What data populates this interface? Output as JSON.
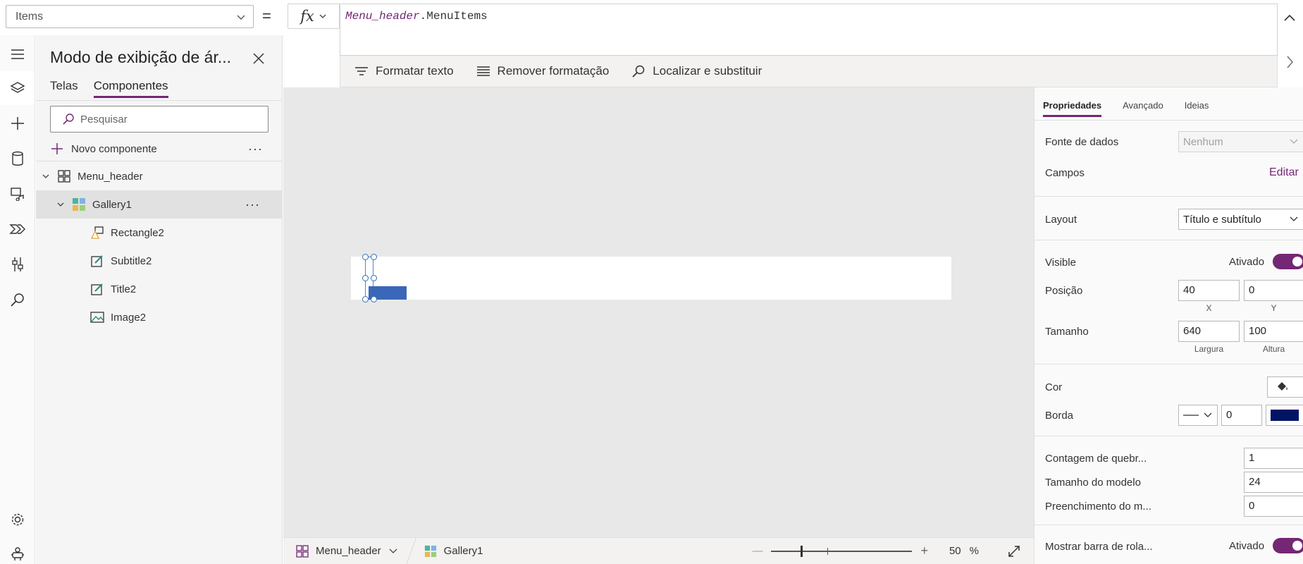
{
  "formula": {
    "property_selected": "Items",
    "equals": "=",
    "fx_label": "fx",
    "expr_control": "Menu_header",
    "expr_dot": ".",
    "expr_property": "MenuItems",
    "tools": {
      "format_text": "Formatar texto",
      "remove_formatting": "Remover formatação",
      "find_replace": "Localizar e substituir"
    }
  },
  "rail": {
    "items": [
      "hamburger-icon",
      "layers-icon",
      "plus-icon",
      "database-icon",
      "media-icon",
      "power-automate-icon",
      "tools-icon",
      "search-icon",
      "settings-icon",
      "virtual-agent-icon"
    ]
  },
  "tree": {
    "title": "Modo de exibição de ár...",
    "tabs": [
      "Telas",
      "Componentes"
    ],
    "active_tab": "Componentes",
    "search_placeholder": "Pesquisar",
    "new_component": "Novo componente",
    "more": "···",
    "nodes": [
      {
        "label": "Menu_header",
        "icon": "component-icon",
        "level": 0,
        "expanded": true
      },
      {
        "label": "Gallery1",
        "icon": "gallery-icon",
        "level": 1,
        "expanded": true,
        "selected": true
      },
      {
        "label": "Rectangle2",
        "icon": "shapes-icon",
        "level": 2
      },
      {
        "label": "Subtitle2",
        "icon": "label-edit-icon",
        "level": 2
      },
      {
        "label": "Title2",
        "icon": "label-edit-icon",
        "level": 2
      },
      {
        "label": "Image2",
        "icon": "image-icon",
        "level": 2
      }
    ]
  },
  "status": {
    "crumb_component": "Menu_header",
    "crumb_control": "Gallery1",
    "zoom_minus": "—",
    "zoom_plus": "+",
    "zoom_value": "50",
    "zoom_unit": "%",
    "zoom_level": 50
  },
  "props": {
    "tabs": [
      "Propriedades",
      "Avançado",
      "Ideias"
    ],
    "active_tab": "Propriedades",
    "data_source_label": "Fonte de dados",
    "data_source_value": "Nenhum",
    "fields_label": "Campos",
    "fields_edit": "Editar",
    "layout_label": "Layout",
    "layout_value": "Título e subtítulo",
    "visible_label": "Visible",
    "visible_value": "Ativado",
    "position_label": "Posição",
    "position_x": "40",
    "position_y": "0",
    "x_caption": "X",
    "y_caption": "Y",
    "size_label": "Tamanho",
    "size_w": "640",
    "size_h": "100",
    "w_caption": "Largura",
    "h_caption": "Altura",
    "color_label": "Cor",
    "border_label": "Borda",
    "border_width": "0",
    "border_color": "#001464",
    "wrap_count_label": "Contagem de quebr...",
    "wrap_count_value": "1",
    "template_size_label": "Tamanho do modelo",
    "template_size_value": "24",
    "template_padding_label": "Preenchimento do m...",
    "template_padding_value": "0",
    "scrollbar_label": "Mostrar barra de rola...",
    "scrollbar_value": "Ativado"
  },
  "colors": {
    "accent": "#742774",
    "selection": "#3a67b8",
    "canvas_bg": "#e8e8e8"
  }
}
